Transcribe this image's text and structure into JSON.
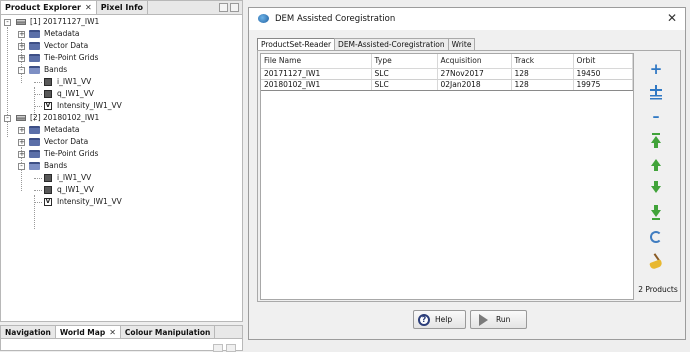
{
  "explorer": {
    "tabs": [
      {
        "label": "Product Explorer",
        "close": "✕"
      },
      {
        "label": "Pixel Info"
      }
    ],
    "products": [
      {
        "label": "[1] 20171127_IW1",
        "children": [
          "Metadata",
          "Vector Data",
          "Tie-Point Grids",
          "Bands"
        ],
        "bands": [
          "i_IW1_VV",
          "q_IW1_VV",
          "Intensity_IW1_VV"
        ]
      },
      {
        "label": "[2] 20180102_IW1",
        "children": [
          "Metadata",
          "Vector Data",
          "Tie-Point Grids",
          "Bands"
        ],
        "bands": [
          "i_IW1_VV",
          "q_IW1_VV",
          "Intensity_IW1_VV"
        ]
      }
    ],
    "expander_minus": "-",
    "expander_plus": "+",
    "virtual_band_letter": "V"
  },
  "bottom_panel": {
    "tabs": [
      "Navigation",
      "World Map",
      "Colour Manipulation"
    ],
    "close": "✕"
  },
  "dialog": {
    "title": "DEM Assisted Coregistration",
    "close": "✕",
    "tabs": [
      "ProductSet-Reader",
      "DEM-Assisted-Coregistration",
      "Write"
    ],
    "active_tab": "ProductSet-Reader",
    "table": {
      "headers": [
        "File Name",
        "Type",
        "Acquisition",
        "Track",
        "Orbit"
      ],
      "rows": [
        [
          "20171127_IW1",
          "SLC",
          "27Nov2017",
          "128",
          "19450"
        ],
        [
          "20180102_IW1",
          "SLC",
          "02Jan2018",
          "128",
          "19975"
        ]
      ]
    },
    "product_count": "2 Products",
    "buttons": {
      "help": "Help",
      "run": "Run"
    },
    "help_glyph": "?"
  },
  "colors": {
    "accent_blue": "#2f78c4",
    "arrow_green": "#41a33a",
    "folder_blue": "#5b6fa8"
  },
  "icons": {
    "add": "add-icon",
    "add_opened": "add-opened-products-icon",
    "remove": "remove-icon",
    "move_top": "move-top-icon",
    "move_up": "move-up-icon",
    "move_down": "move-down-icon",
    "move_bottom": "move-bottom-icon",
    "refresh": "refresh-icon",
    "clear": "clear-broom-icon"
  }
}
